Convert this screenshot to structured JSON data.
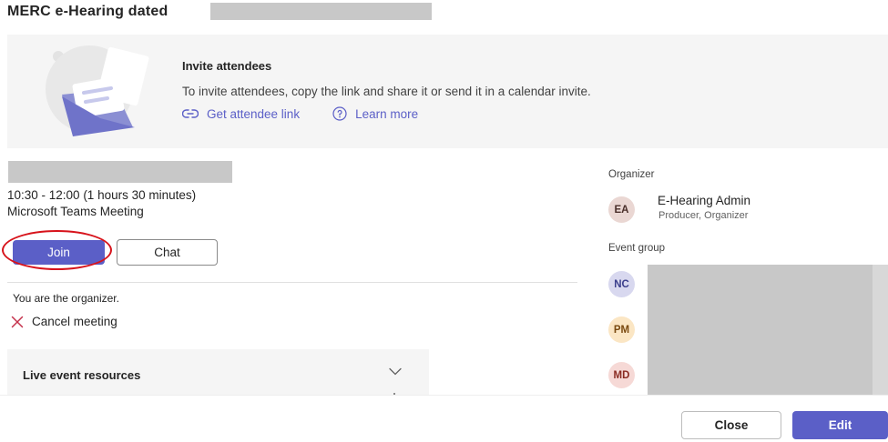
{
  "header": {
    "title": "MERC e-Hearing dated"
  },
  "invite": {
    "title": "Invite attendees",
    "description": "To invite attendees, copy the link and share it or send it in a calendar invite.",
    "get_link_label": "Get attendee link",
    "learn_more_label": "Learn more"
  },
  "meeting": {
    "time": "10:30 - 12:00 (1 hours 30 minutes)",
    "type": "Microsoft Teams Meeting",
    "join_label": "Join",
    "chat_label": "Chat",
    "organizer_note": "You are the organizer.",
    "cancel_label": "Cancel meeting"
  },
  "resources": {
    "title": "Live event resources"
  },
  "organizer": {
    "section_label": "Organizer",
    "initials": "EA",
    "name": "E-Hearing Admin",
    "role": "Producer, Organizer"
  },
  "event_group": {
    "section_label": "Event group",
    "members": [
      {
        "initials": "NC"
      },
      {
        "initials": "PM"
      },
      {
        "initials": "MD"
      }
    ]
  },
  "footer": {
    "close_label": "Close",
    "edit_label": "Edit"
  },
  "colors": {
    "accent": "#5b5fc7",
    "annotation_circle": "#d7131b",
    "redaction": "#c8c8c8"
  },
  "icons": [
    "invite-illustration",
    "link-icon",
    "help-circle-icon",
    "close-x-icon",
    "chevron-down-icon"
  ]
}
